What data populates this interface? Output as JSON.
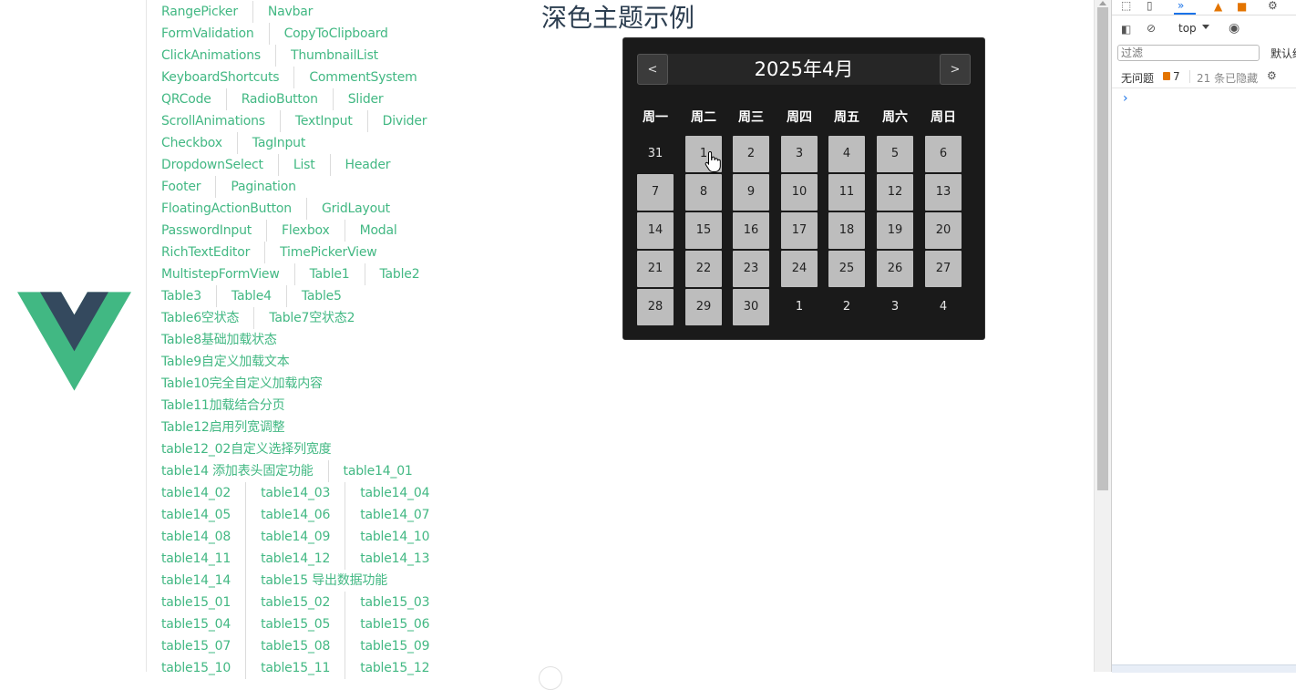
{
  "nav": {
    "rows": [
      [
        "RangePicker",
        "Navbar"
      ],
      [
        "FormValidation",
        "CopyToClipboard"
      ],
      [
        "ClickAnimations",
        "ThumbnailList"
      ],
      [
        "KeyboardShortcuts",
        "CommentSystem"
      ],
      [
        "QRCode",
        "RadioButton",
        "Slider"
      ],
      [
        "ScrollAnimations",
        "TextInput",
        "Divider"
      ],
      [
        "Checkbox",
        "TagInput"
      ],
      [
        "DropdownSelect",
        "List",
        "Header"
      ],
      [
        "Footer",
        "Pagination"
      ],
      [
        "FloatingActionButton",
        "GridLayout"
      ],
      [
        "PasswordInput",
        "Flexbox",
        "Modal"
      ],
      [
        "RichTextEditor",
        "TimePickerView"
      ],
      [
        "MultistepFormView",
        "Table1",
        "Table2"
      ],
      [
        "Table3",
        "Table4",
        "Table5"
      ],
      [
        "Table6空状态",
        "Table7空状态2"
      ],
      [
        "Table8基础加载状态"
      ],
      [
        "Table9自定义加载文本"
      ],
      [
        "Table10完全自定义加载内容"
      ],
      [
        "Table11加载结合分页"
      ],
      [
        "Table12启用列宽调整"
      ],
      [
        "table12_02自定义选择列宽度"
      ],
      [
        "table14 添加表头固定功能",
        "table14_01"
      ],
      [
        "table14_02",
        "table14_03",
        "table14_04"
      ],
      [
        "table14_05",
        "table14_06",
        "table14_07"
      ],
      [
        "table14_08",
        "table14_09",
        "table14_10"
      ],
      [
        "table14_11",
        "table14_12",
        "table14_13"
      ],
      [
        "table14_14",
        "table15 导出数据功能"
      ],
      [
        "table15_01",
        "table15_02",
        "table15_03"
      ],
      [
        "table15_04",
        "table15_05",
        "table15_06"
      ],
      [
        "table15_07",
        "table15_08",
        "table15_09"
      ],
      [
        "table15_10",
        "table15_11",
        "table15_12"
      ]
    ]
  },
  "page": {
    "title": "深色主题示例"
  },
  "calendar": {
    "title": "2025年4月",
    "prev_label": "<",
    "next_label": ">",
    "weekdays": [
      "周一",
      "周二",
      "周三",
      "周四",
      "周五",
      "周六",
      "周日"
    ],
    "days": [
      {
        "label": "31",
        "current": false
      },
      {
        "label": "1",
        "current": true
      },
      {
        "label": "2",
        "current": true
      },
      {
        "label": "3",
        "current": true
      },
      {
        "label": "4",
        "current": true
      },
      {
        "label": "5",
        "current": true
      },
      {
        "label": "6",
        "current": true
      },
      {
        "label": "7",
        "current": true
      },
      {
        "label": "8",
        "current": true
      },
      {
        "label": "9",
        "current": true
      },
      {
        "label": "10",
        "current": true
      },
      {
        "label": "11",
        "current": true
      },
      {
        "label": "12",
        "current": true
      },
      {
        "label": "13",
        "current": true
      },
      {
        "label": "14",
        "current": true
      },
      {
        "label": "15",
        "current": true
      },
      {
        "label": "16",
        "current": true
      },
      {
        "label": "17",
        "current": true
      },
      {
        "label": "18",
        "current": true
      },
      {
        "label": "19",
        "current": true
      },
      {
        "label": "20",
        "current": true
      },
      {
        "label": "21",
        "current": true
      },
      {
        "label": "22",
        "current": true
      },
      {
        "label": "23",
        "current": true
      },
      {
        "label": "24",
        "current": true
      },
      {
        "label": "25",
        "current": true
      },
      {
        "label": "26",
        "current": true
      },
      {
        "label": "27",
        "current": true
      },
      {
        "label": "28",
        "current": true
      },
      {
        "label": "29",
        "current": true
      },
      {
        "label": "30",
        "current": true
      },
      {
        "label": "1",
        "current": false
      },
      {
        "label": "2",
        "current": false
      },
      {
        "label": "3",
        "current": false
      },
      {
        "label": "4",
        "current": false
      }
    ]
  },
  "devtools": {
    "context": "top",
    "filter_placeholder": "过滤",
    "levels_label": "默认级",
    "issues_label": "无问题",
    "issues_count": "7",
    "hidden_label": "21 条已隐藏",
    "console_prompt": "›"
  },
  "colors": {
    "link": "#42b883",
    "calendar_bg": "#1a1a1a",
    "day_bg": "#bdbdbd",
    "vue_green": "#41b883",
    "vue_dark": "#34495e"
  }
}
